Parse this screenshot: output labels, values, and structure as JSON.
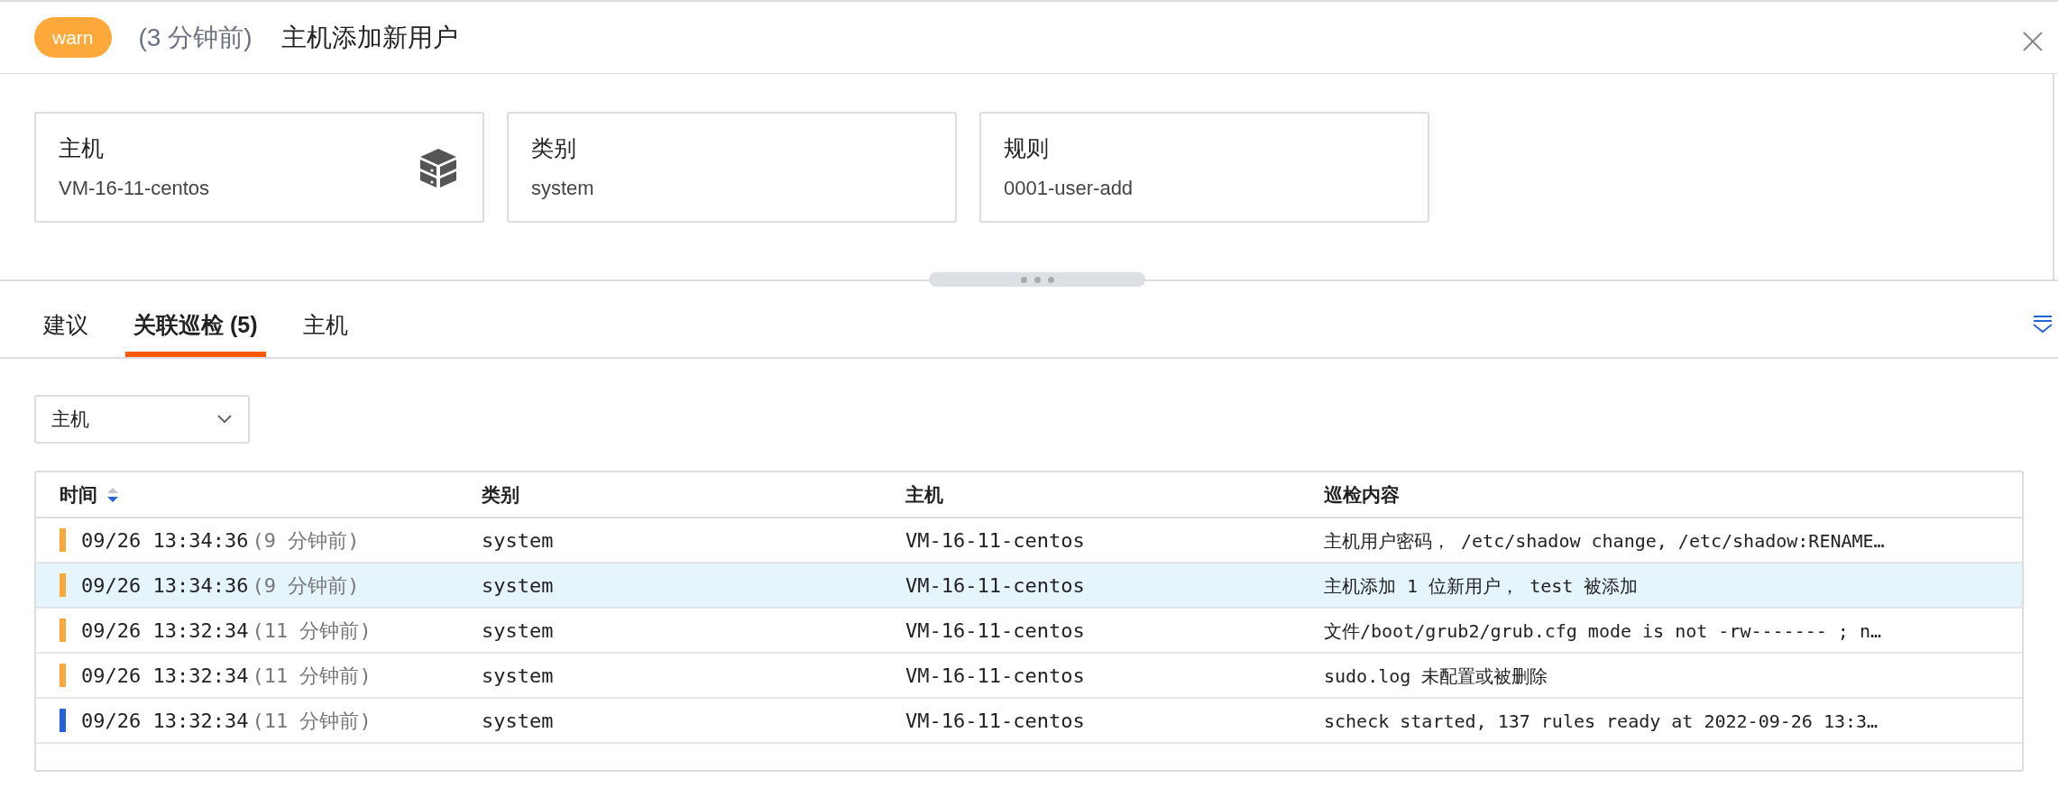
{
  "header": {
    "level_badge": "warn",
    "ago": "(3 分钟前)",
    "title": "主机添加新用户"
  },
  "cards": [
    {
      "label": "主机",
      "value": "VM-16-11-centos",
      "has_icon": true
    },
    {
      "label": "类别",
      "value": "system",
      "has_icon": false
    },
    {
      "label": "规则",
      "value": "0001-user-add",
      "has_icon": false
    }
  ],
  "tabs": [
    {
      "label": "建议",
      "selected": false
    },
    {
      "label": "关联巡检 (5)",
      "selected": true
    },
    {
      "label": "主机",
      "selected": false
    }
  ],
  "filter": {
    "value": "主机"
  },
  "table": {
    "columns": [
      "时间",
      "类别",
      "主机",
      "巡检内容"
    ],
    "rows": [
      {
        "color": "#f7a93c",
        "selected": false,
        "time": "09/26 13:34:36",
        "ago": "(9 分钟前)",
        "category": "system",
        "host": "VM-16-11-centos",
        "content": "主机用户密码，  /etc/shadow change, /etc/shadow:RENAME…"
      },
      {
        "color": "#f7a93c",
        "selected": true,
        "time": "09/26 13:34:36",
        "ago": "(9 分钟前)",
        "category": "system",
        "host": "VM-16-11-centos",
        "content": "主机添加 1 位新用户，  test 被添加"
      },
      {
        "color": "#f7a93c",
        "selected": false,
        "time": "09/26 13:32:34",
        "ago": "(11 分钟前)",
        "category": "system",
        "host": "VM-16-11-centos",
        "content": "文件/boot/grub2/grub.cfg mode is not -rw------- ; n…"
      },
      {
        "color": "#f7a93c",
        "selected": false,
        "time": "09/26 13:32:34",
        "ago": "(11 分钟前)",
        "category": "system",
        "host": "VM-16-11-centos",
        "content": "sudo.log 未配置或被删除"
      },
      {
        "color": "#2563d9",
        "selected": false,
        "time": "09/26 13:32:34",
        "ago": "(11 分钟前)",
        "category": "system",
        "host": "VM-16-11-centos",
        "content": "scheck started, 137 rules ready at 2022-09-26 13:3…"
      }
    ]
  }
}
